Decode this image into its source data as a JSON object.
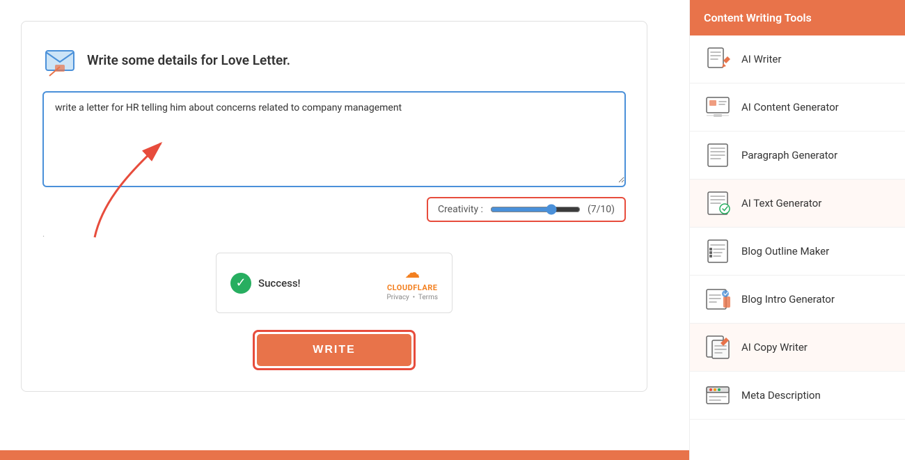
{
  "form": {
    "title": "Write some details for Love Letter.",
    "textarea_value": "write a letter for HR telling him about concerns related to company management",
    "textarea_placeholder": "",
    "creativity_label": "Creativity :",
    "creativity_value": "(7/10)",
    "slider_value": 7,
    "slider_min": 0,
    "slider_max": 10,
    "dot_label": ".",
    "write_button_label": "WRITE",
    "success_text": "Success!",
    "cloudflare_label": "CLOUDFLARE",
    "cloudflare_links": "Privacy  •  Terms"
  },
  "sidebar": {
    "header": "Content Writing Tools",
    "items": [
      {
        "id": "ai-writer",
        "label": "AI Writer"
      },
      {
        "id": "ai-content-generator",
        "label": "AI Content Generator"
      },
      {
        "id": "paragraph-generator",
        "label": "Paragraph Generator"
      },
      {
        "id": "ai-text-generator",
        "label": "AI Text Generator"
      },
      {
        "id": "blog-outline-maker",
        "label": "Blog Outline Maker"
      },
      {
        "id": "blog-intro-generator",
        "label": "Blog Intro Generator"
      },
      {
        "id": "ai-copy-writer",
        "label": "AI Copy Writer"
      },
      {
        "id": "meta-description",
        "label": "Meta Description"
      }
    ]
  }
}
